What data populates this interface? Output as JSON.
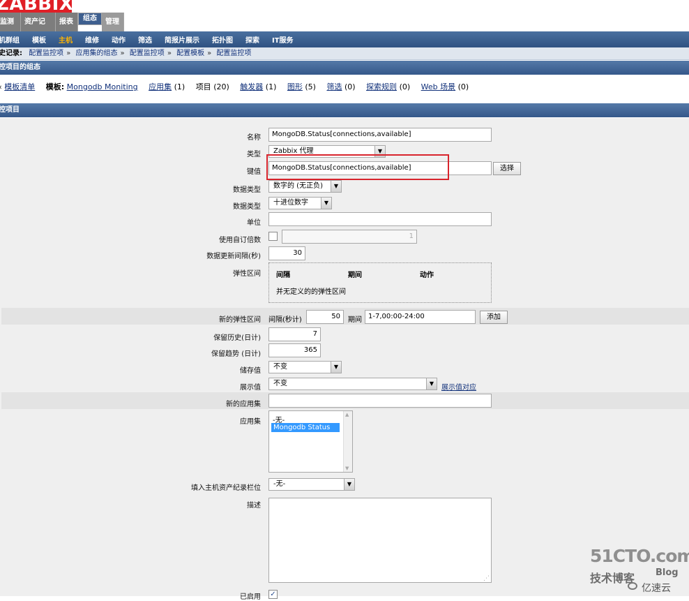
{
  "logo": "ZABBIX",
  "main_tabs": [
    "监测中",
    "资产记录",
    "报表",
    "组态",
    "管理"
  ],
  "sub_nav": [
    "主机群组",
    "模板",
    "主机",
    "维修",
    "动作",
    "筛选",
    "简报片展示",
    "拓扑图",
    "探索",
    "IT服务"
  ],
  "history": {
    "label": "历史记录:",
    "items": [
      "配置监控项",
      "应用集的组态",
      "配置监控项",
      "配置模板",
      "配置监控项"
    ]
  },
  "section_title": "监控项目的组态",
  "template_nav": {
    "list_link": "模板清单",
    "template_label": "模板:",
    "template_name": "Mongodb Moniting",
    "apps_label": "应用集",
    "apps_count": "(1)",
    "items_label": "项目",
    "items_count": "(20)",
    "triggers_label": "触发器",
    "triggers_count": "(1)",
    "graphs_label": "图形",
    "graphs_count": "(5)",
    "screens_label": "筛选",
    "screens_count": "(0)",
    "discovery_label": "探索规则",
    "discovery_count": "(0)",
    "web_label": "Web 场景",
    "web_count": "(0)"
  },
  "form_header": "监控项目",
  "form": {
    "name_label": "名称",
    "name_value": "MongoDB.Status[connections,available]",
    "type_label": "类型",
    "type_value": "Zabbix 代理",
    "key_label": "键值",
    "key_value": "MongoDB.Status[connections,available]",
    "select_button": "选择",
    "info_type_label": "数据类型",
    "info_type_value": "数字的 (无正负)",
    "data_type_label": "数据类型",
    "data_type_value": "十进位数字",
    "units_label": "单位",
    "units_value": "",
    "multiplier_label": "使用自订倍数",
    "multiplier_value": "1",
    "delay_label": "数据更新间隔(秒)",
    "delay_value": "30",
    "flex_label": "弹性区间",
    "flex_headers": [
      "间隔",
      "期间",
      "动作"
    ],
    "flex_empty": "并无定义的的弹性区间",
    "new_flex_label": "新的弹性区间",
    "new_flex_interval_label": "间隔(秒计)",
    "new_flex_interval_value": "50",
    "new_flex_period_label": "期间",
    "new_flex_period_value": "1-7,00:00-24:00",
    "add_button": "添加",
    "history_label": "保留历史(日计)",
    "history_value": "7",
    "trends_label": "保留趋势 (日计)",
    "trends_value": "365",
    "store_label": "储存值",
    "store_value": "不变",
    "show_label": "展示值",
    "show_value": "不变",
    "value_map_link": "展示值对应",
    "new_app_label": "新的应用集",
    "new_app_value": "",
    "apps_label": "应用集",
    "apps_options": [
      "-无-",
      "Mongodb Status"
    ],
    "inventory_label": "填入主机资产纪录栏位",
    "inventory_value": "-无-",
    "description_label": "描述",
    "description_value": "",
    "enabled_label": "已启用"
  },
  "watermark": {
    "line1": "51CTO.com",
    "line2": "技术博客",
    "line3": "Blog",
    "line4": "亿速云"
  },
  "colors": {
    "logo_red": "#e01f26",
    "nav_blue": "#3e5f8f",
    "active_orange": "#ffb400",
    "highlight_red": "#d8242c",
    "selected_option": "#3399ff"
  }
}
